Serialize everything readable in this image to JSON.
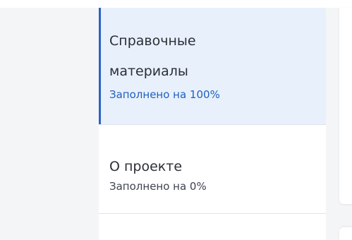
{
  "nav": {
    "items": [
      {
        "title_line1": "Справочные",
        "title_line2": "материалы",
        "status": "Заполнено на 100%",
        "status_color": "#1f5fbf",
        "active": true
      },
      {
        "title_line1": "О проекте",
        "status": "Заполнено на 0%",
        "status_color": "#3d4450",
        "active": false
      }
    ]
  },
  "colors": {
    "accent": "#2a63c6",
    "active_bg": "#e8f0fc",
    "page_bg": "#f4f5f7"
  }
}
